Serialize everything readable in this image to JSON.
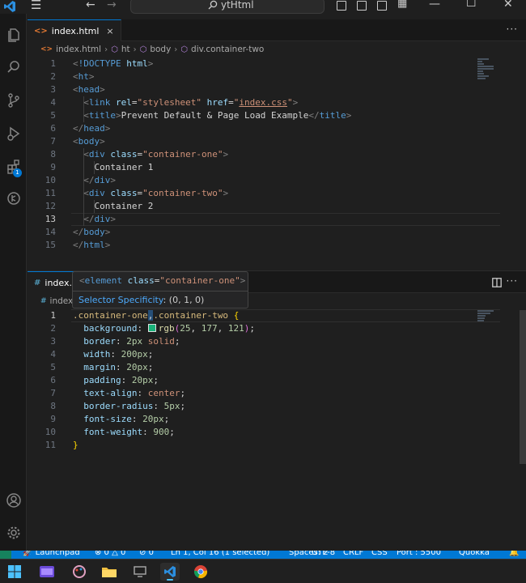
{
  "titlebar": {
    "search_text": "ytHtml"
  },
  "activity": {
    "extensions_badge": "1"
  },
  "editor_top": {
    "tab": {
      "label": "index.html",
      "close": "×",
      "icon": "<>"
    },
    "tab_actions": "···",
    "breadcrumb": [
      "index.html",
      "ht",
      "body",
      "div.container-two"
    ],
    "line_numbers": [
      "1",
      "2",
      "3",
      "4",
      "5",
      "6",
      "7",
      "8",
      "9",
      "10",
      "11",
      "12",
      "13",
      "14",
      "15"
    ]
  },
  "editor_bottom": {
    "tab": {
      "label": "index.c",
      "icon": "#"
    },
    "breadcrumb": "index",
    "tab_actions": "···",
    "line_numbers": [
      "1",
      "2",
      "3",
      "4",
      "5",
      "6",
      "7",
      "8",
      "9",
      "10",
      "11"
    ]
  },
  "hover": {
    "element_line": "<element class=\"container-one\">",
    "specificity_label": "Selector Specificity",
    "specificity_value": ": (0, 1, 0)"
  },
  "statusbar": {
    "launchpad": "Launchpad",
    "problems": "⊗ 0 △ 0",
    "ports_count": "0",
    "position": "Ln 1, Col 16 (1 selected)",
    "spaces": "Spaces: 2",
    "encoding": "UTF-8",
    "eol": "CRLF",
    "language": "CSS",
    "port": "Port : 5500",
    "quokka": "Quokka"
  },
  "colors": {
    "accent": "#0078d4",
    "swatch": "#19b179",
    "remote": "#16825d"
  }
}
